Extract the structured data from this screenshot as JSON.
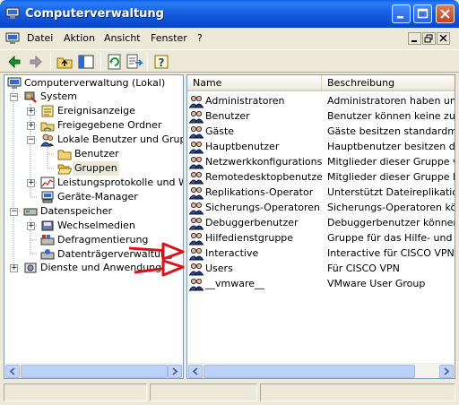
{
  "window": {
    "title": "Computerverwaltung"
  },
  "menu": [
    {
      "label": "Datei"
    },
    {
      "label": "Aktion"
    },
    {
      "label": "Ansicht"
    },
    {
      "label": "Fenster"
    },
    {
      "label": "?"
    }
  ],
  "tree": [
    {
      "label": "Computerverwaltung (Lokal)",
      "icon": "computer-management-icon"
    },
    {
      "label": "System",
      "icon": "system-tools-icon"
    },
    {
      "label": "Ereignisanzeige",
      "icon": "event-viewer-icon"
    },
    {
      "label": "Freigegebene Ordner",
      "icon": "shared-folders-icon"
    },
    {
      "label": "Lokale Benutzer und Gruppen",
      "icon": "users-groups-icon"
    },
    {
      "label": "Benutzer",
      "icon": "folder-icon"
    },
    {
      "label": "Gruppen",
      "icon": "open-folder-icon"
    },
    {
      "label": "Leistungsprotokolle und Warnungen",
      "icon": "performance-icon"
    },
    {
      "label": "Geräte-Manager",
      "icon": "device-manager-icon"
    },
    {
      "label": "Datenspeicher",
      "icon": "storage-icon"
    },
    {
      "label": "Wechselmedien",
      "icon": "removable-media-icon"
    },
    {
      "label": "Defragmentierung",
      "icon": "defrag-icon"
    },
    {
      "label": "Datenträgerverwaltung",
      "icon": "disk-management-icon"
    },
    {
      "label": "Dienste und Anwendungen",
      "icon": "services-icon"
    }
  ],
  "list": {
    "columns": [
      "Name",
      "Beschreibung"
    ],
    "rows": [
      {
        "name": "Administratoren",
        "desc": "Administratoren haben uneingeschränkten"
      },
      {
        "name": "Benutzer",
        "desc": "Benutzer können keine zufälligen"
      },
      {
        "name": "Gäste",
        "desc": "Gäste besitzen standardmäßig"
      },
      {
        "name": "Hauptbenutzer",
        "desc": "Hauptbenutzer besitzen die meisten"
      },
      {
        "name": "Netzwerkkonfigurations...",
        "desc": "Mitglieder dieser Gruppe verfügen"
      },
      {
        "name": "Remotedesktopbenutzer",
        "desc": "Mitglieder dieser Gruppe haben"
      },
      {
        "name": "Replikations-Operator",
        "desc": "Unterstützt Dateireplikation in"
      },
      {
        "name": "Sicherungs-Operatoren",
        "desc": "Sicherungs-Operatoren können"
      },
      {
        "name": "Debuggerbenutzer",
        "desc": "Debuggerbenutzer können Prozesse"
      },
      {
        "name": "Hilfedienstgruppe",
        "desc": "Gruppe für das Hilfe- und Support"
      },
      {
        "name": "Interactive",
        "desc": "Interactive für CISCO VPN"
      },
      {
        "name": "Users",
        "desc": "Für CISCO VPN"
      },
      {
        "name": "__vmware__",
        "desc": "VMware User Group"
      }
    ]
  },
  "colors": {
    "annotation_arrow": "#E0101A",
    "titlebar": "#0A5FE6",
    "selection": "#ECE9D8"
  }
}
